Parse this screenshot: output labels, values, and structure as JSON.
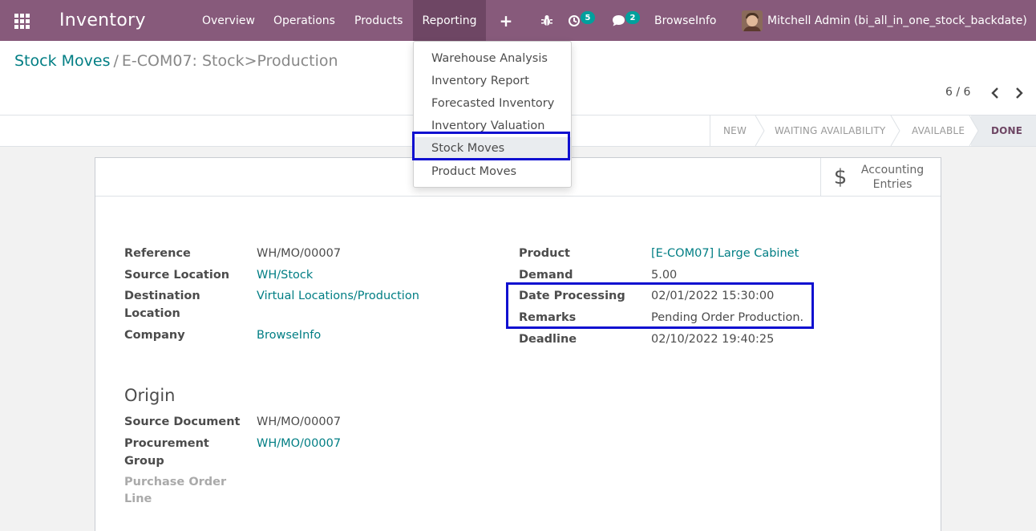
{
  "navbar": {
    "app_name": "Inventory",
    "menu": [
      "Overview",
      "Operations",
      "Products",
      "Reporting"
    ],
    "activity_count": "5",
    "message_count": "2",
    "company": "BrowseInfo",
    "user": "Mitchell Admin (bi_all_in_one_stock_backdate)",
    "icons": {
      "apps": "apps-grid-icon",
      "plus": "plus-icon",
      "debug": "bug-icon",
      "activity": "clock-icon",
      "messages": "chat-icon"
    }
  },
  "reporting_menu": {
    "items": [
      "Warehouse Analysis",
      "Inventory Report",
      "Forecasted Inventory",
      "Inventory Valuation",
      "Stock Moves",
      "Product Moves"
    ],
    "selected": "Stock Moves"
  },
  "breadcrumb": {
    "parent": "Stock Moves",
    "separator": "/",
    "current": "E-COM07: Stock>Production"
  },
  "pager": {
    "value": "6 / 6"
  },
  "status": {
    "stages": [
      "NEW",
      "WAITING AVAILABILITY",
      "AVAILABLE",
      "DONE"
    ],
    "current": "DONE"
  },
  "smart_button": {
    "line1": "Accounting",
    "line2": "Entries",
    "icon": "dollar-icon"
  },
  "form": {
    "reference": {
      "label": "Reference",
      "value": "WH/MO/00007"
    },
    "source_location": {
      "label": "Source Location",
      "value": "WH/Stock"
    },
    "destination_location": {
      "label_line1": "Destination",
      "label_line2": "Location",
      "value": "Virtual Locations/Production"
    },
    "company": {
      "label": "Company",
      "value": "BrowseInfo"
    },
    "product": {
      "label": "Product",
      "value": "[E-COM07] Large Cabinet"
    },
    "demand": {
      "label": "Demand",
      "value": "5.00"
    },
    "date_processing": {
      "label": "Date Processing",
      "value": "02/01/2022 15:30:00"
    },
    "remarks": {
      "label": "Remarks",
      "value": "Pending Order Production."
    },
    "deadline": {
      "label": "Deadline",
      "value": "02/10/2022 19:40:25"
    },
    "origin_title": "Origin",
    "source_document": {
      "label": "Source Document",
      "value": "WH/MO/00007"
    },
    "procurement_group": {
      "label_line1": "Procurement",
      "label_line2": "Group",
      "value": "WH/MO/00007"
    },
    "purchase_order_line": {
      "label_line1": "Purchase Order",
      "label_line2": "Line"
    }
  },
  "colors": {
    "navbar": "#875a7b",
    "link": "#017e84",
    "highlight": "#1010d0",
    "badge": "#00a09d"
  }
}
